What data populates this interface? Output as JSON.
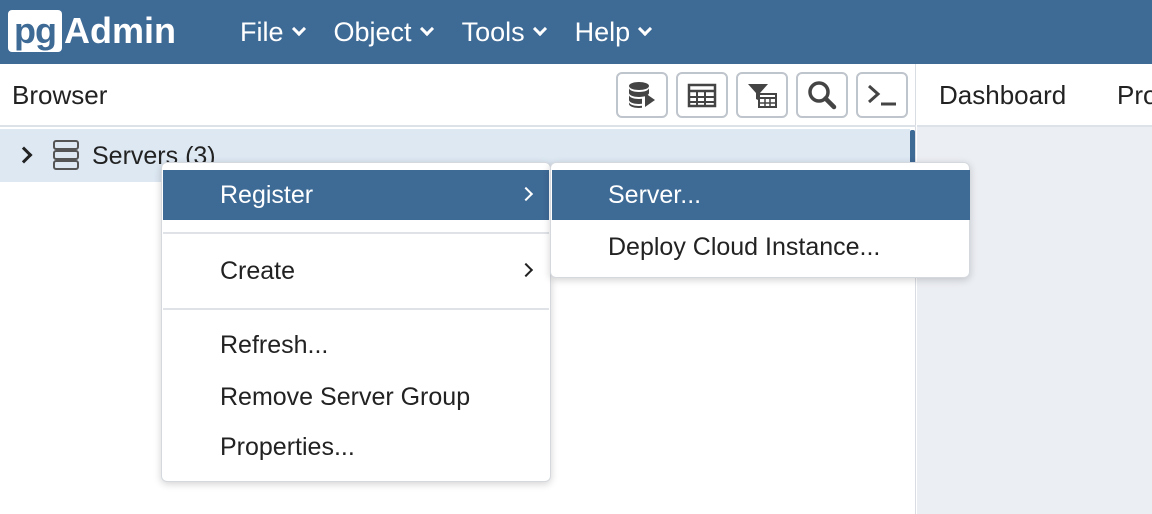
{
  "app": {
    "logo_pg": "pg",
    "logo_admin": "Admin",
    "accent_color": "#3e6a96"
  },
  "menu": {
    "items": [
      {
        "label": "File"
      },
      {
        "label": "Object"
      },
      {
        "label": "Tools"
      },
      {
        "label": "Help"
      }
    ]
  },
  "browser": {
    "title": "Browser",
    "toolbar": [
      {
        "icon": "query-tool-icon"
      },
      {
        "icon": "view-data-icon"
      },
      {
        "icon": "filtered-rows-icon"
      },
      {
        "icon": "search-objects-icon"
      },
      {
        "icon": "psql-tool-icon"
      }
    ],
    "tree": {
      "label": "Servers (3)"
    }
  },
  "right_panel": {
    "tabs": [
      {
        "label": "Dashboard"
      },
      {
        "label": "Properties"
      }
    ]
  },
  "context_menu": {
    "items": [
      {
        "label": "Register",
        "has_submenu": true
      },
      {
        "label": "Create",
        "has_submenu": true
      },
      {
        "label": "Refresh..."
      },
      {
        "label": "Remove Server Group"
      },
      {
        "label": "Properties..."
      }
    ]
  },
  "submenu": {
    "items": [
      {
        "label": "Server..."
      },
      {
        "label": "Deploy Cloud Instance..."
      }
    ]
  }
}
